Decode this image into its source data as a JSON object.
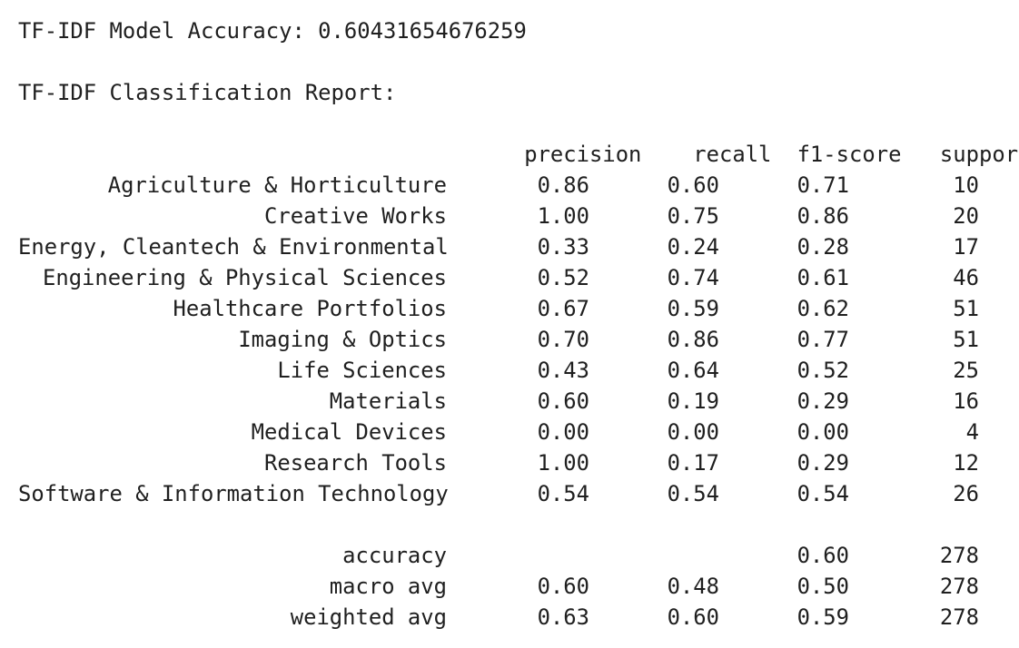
{
  "output": {
    "accuracy_line": "TF-IDF Model Accuracy: 0.60431654676259",
    "report_title": "TF-IDF Classification Report:"
  },
  "columns": [
    "precision",
    "recall",
    "f1-score",
    "support"
  ],
  "classes": [
    {
      "label": "Agriculture & Horticulture",
      "precision": "0.86",
      "recall": "0.60",
      "f1": "0.71",
      "support": "10"
    },
    {
      "label": "Creative Works",
      "precision": "1.00",
      "recall": "0.75",
      "f1": "0.86",
      "support": "20"
    },
    {
      "label": "Energy, Cleantech & Environmental",
      "precision": "0.33",
      "recall": "0.24",
      "f1": "0.28",
      "support": "17"
    },
    {
      "label": "Engineering & Physical Sciences",
      "precision": "0.52",
      "recall": "0.74",
      "f1": "0.61",
      "support": "46"
    },
    {
      "label": "Healthcare Portfolios",
      "precision": "0.67",
      "recall": "0.59",
      "f1": "0.62",
      "support": "51"
    },
    {
      "label": "Imaging & Optics",
      "precision": "0.70",
      "recall": "0.86",
      "f1": "0.77",
      "support": "51"
    },
    {
      "label": "Life Sciences",
      "precision": "0.43",
      "recall": "0.64",
      "f1": "0.52",
      "support": "25"
    },
    {
      "label": "Materials",
      "precision": "0.60",
      "recall": "0.19",
      "f1": "0.29",
      "support": "16"
    },
    {
      "label": "Medical Devices",
      "precision": "0.00",
      "recall": "0.00",
      "f1": "0.00",
      "support": "4"
    },
    {
      "label": "Research Tools",
      "precision": "1.00",
      "recall": "0.17",
      "f1": "0.29",
      "support": "12"
    },
    {
      "label": "Software & Information Technology",
      "precision": "0.54",
      "recall": "0.54",
      "f1": "0.54",
      "support": "26"
    }
  ],
  "summary": [
    {
      "label": "accuracy",
      "precision": "",
      "recall": "",
      "f1": "0.60",
      "support": "278"
    },
    {
      "label": "macro avg",
      "precision": "0.60",
      "recall": "0.48",
      "f1": "0.50",
      "support": "278"
    },
    {
      "label": "weighted avg",
      "precision": "0.63",
      "recall": "0.60",
      "f1": "0.59",
      "support": "278"
    }
  ]
}
